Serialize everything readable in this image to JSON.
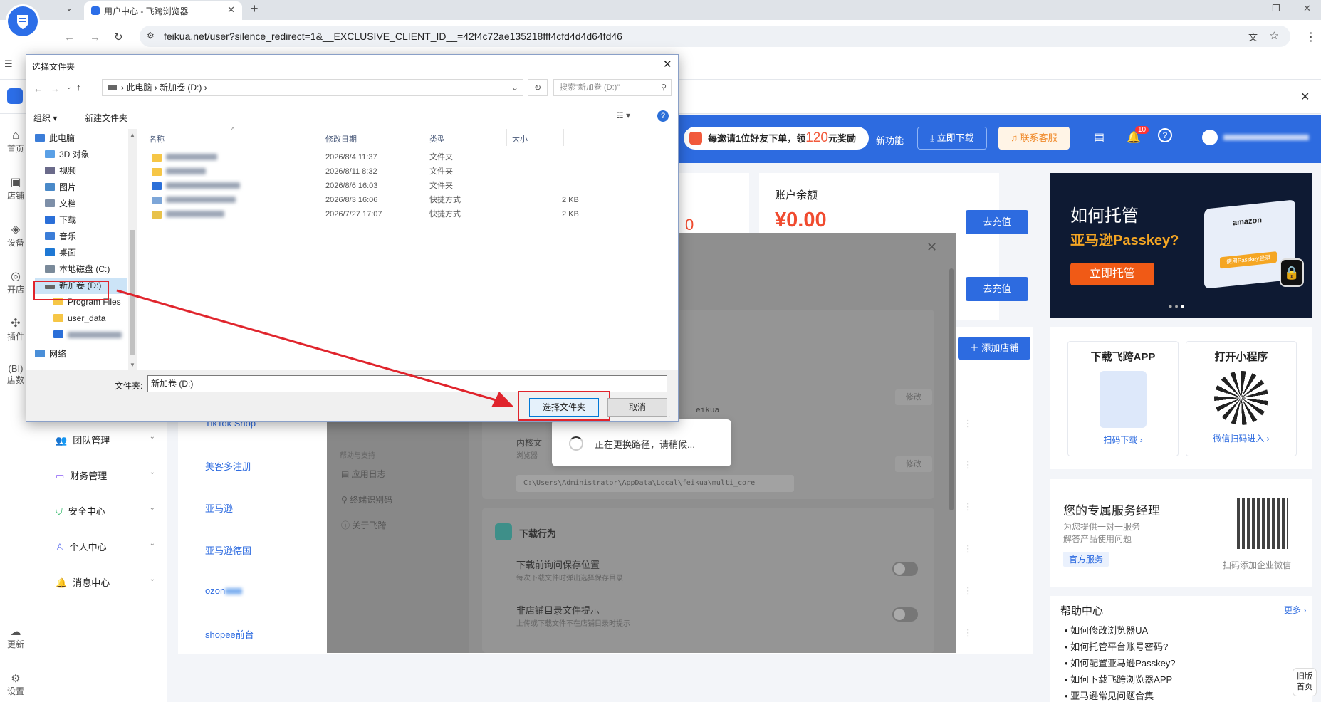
{
  "browser": {
    "tab_title": "用户中心 - 飞跨浏览器",
    "url": "feikua.net/user?silence_redirect=1&__EXCLUSIVE_CLIENT_ID__=42f4c72ae135218fff4cfd4d4d64fd46"
  },
  "nav": {
    "items": [
      "首页",
      "店铺",
      "设备",
      "开店",
      "插件",
      "店数"
    ],
    "update": "更新",
    "settings": "设置"
  },
  "menu": [
    {
      "label": "团队管理"
    },
    {
      "label": "财务管理"
    },
    {
      "label": "安全中心"
    },
    {
      "label": "个人中心"
    },
    {
      "label": "消息中心"
    }
  ],
  "header": {
    "promo": "每邀请1位好友下单，领",
    "promo_amount": "120",
    "promo_suffix": "元奖励",
    "new_feature": "新功能",
    "download": "立即下载",
    "contact": "联系客服",
    "badge": "10"
  },
  "balance": {
    "title": "账户余额",
    "amount": "¥0.00",
    "recharge": "去充值",
    "recharge2": "去充值",
    "count": "0"
  },
  "banner": {
    "title": "如何托管",
    "subtitle": "亚马逊Passkey?",
    "button": "立即托管",
    "brand": "amazon",
    "passkey_btn": "使用Passkey登录"
  },
  "stores": {
    "add": "添加店铺",
    "items": [
      "TikTok Shop",
      "美客多注册",
      "亚马逊",
      "亚马逊德国",
      "ozon",
      "shopee前台"
    ]
  },
  "app": {
    "title1": "下载飞跨APP",
    "link1": "扫码下载",
    "title2": "打开小程序",
    "link2": "微信扫码进入"
  },
  "manager": {
    "title": "您的专属服务经理",
    "desc1": "为您提供一对一服务",
    "desc2": "解答产品使用问题",
    "tag": "官方服务",
    "qr_label": "扫码添加企业微信"
  },
  "help": {
    "title": "帮助中心",
    "more": "更多",
    "items": [
      "如何修改浏览器UA",
      "如何托管平台账号密码?",
      "如何配置亚马逊Passkey?",
      "如何下载飞跨浏览器APP",
      "亚马逊常见问题合集"
    ]
  },
  "old_home": "旧版首页",
  "settings_modal": {
    "left": [
      "帮助与支持",
      "应用日志",
      "终端识别码",
      "关于飞跨"
    ],
    "edit": "修改",
    "kernel": "内核文",
    "kernel_path": "浏览器",
    "path": "C:\\Users\\Administrator\\AppData\\Local\\feikua\\multi_core",
    "feikua": "eikua",
    "section": "下载行为",
    "opt1": "下载前询问保存位置",
    "opt1_desc": "每次下载文件时弹出选择保存目录",
    "opt2": "非店铺目录文件提示",
    "opt2_desc": "上传或下载文件不在店铺目录时提示"
  },
  "loading": "正在更换路径，请稍候...",
  "dialog": {
    "title": "选择文件夹",
    "breadcrumb": [
      "此电脑",
      "新加卷 (D:)"
    ],
    "search_placeholder": "搜索\"新加卷 (D:)\"",
    "organize": "组织",
    "new_folder": "新建文件夹",
    "columns": [
      "名称",
      "修改日期",
      "类型",
      "大小"
    ],
    "files": [
      {
        "date": "2026/8/4 11:37",
        "type": "文件夹",
        "size": ""
      },
      {
        "date": "2026/8/11 8:32",
        "type": "文件夹",
        "size": ""
      },
      {
        "date": "2026/8/6 16:03",
        "type": "文件夹",
        "size": ""
      },
      {
        "date": "2026/8/3 16:06",
        "type": "快捷方式",
        "size": "2 KB"
      },
      {
        "date": "2026/7/27 17:07",
        "type": "快捷方式",
        "size": "2 KB"
      }
    ],
    "tree": [
      "此电脑",
      "3D 对象",
      "视频",
      "图片",
      "文档",
      "下载",
      "音乐",
      "桌面",
      "本地磁盘 (C:)",
      "新加卷 (D:)",
      "Program Files",
      "user_data",
      "",
      "网络"
    ],
    "folder_label": "文件夹:",
    "folder_value": "新加卷 (D:)",
    "ok": "选择文件夹",
    "cancel": "取消"
  }
}
